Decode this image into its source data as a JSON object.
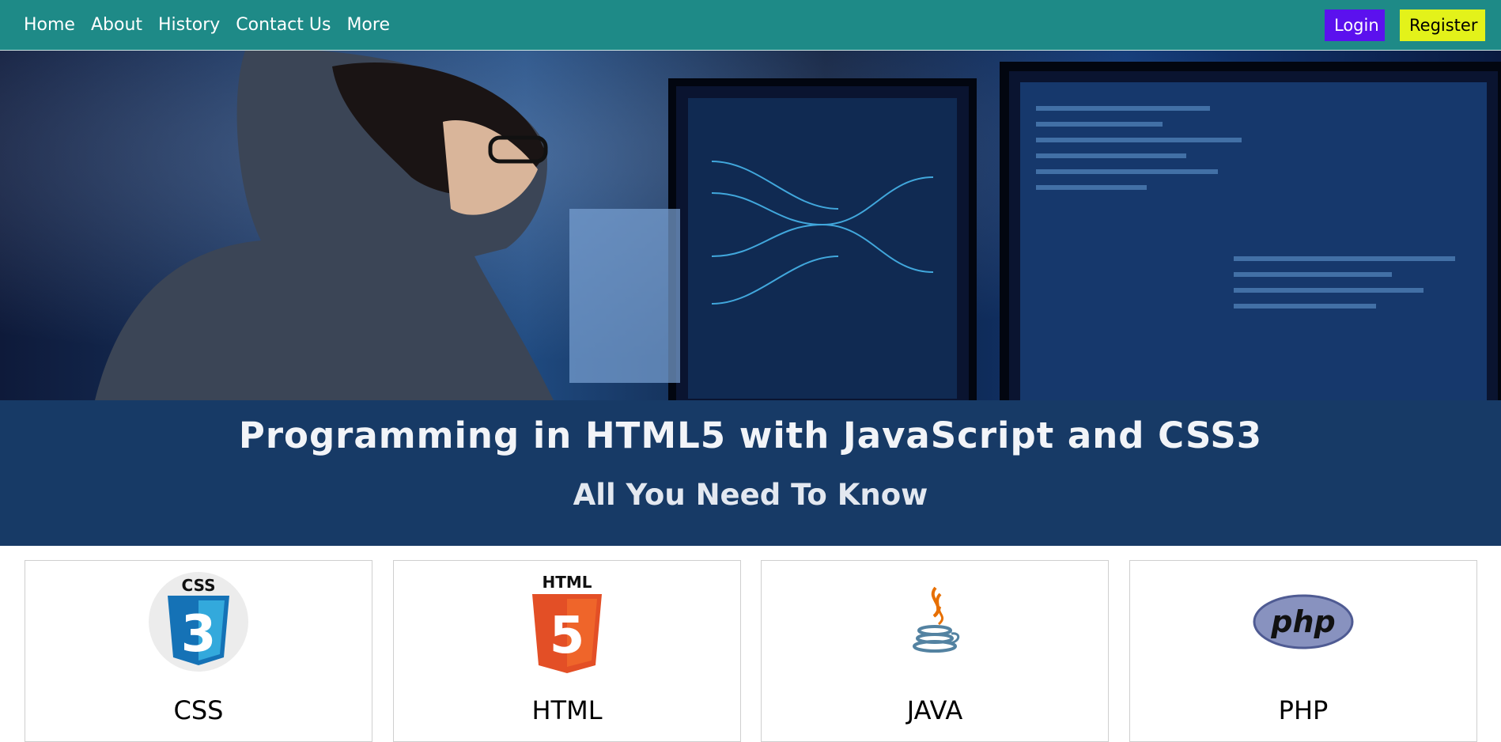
{
  "nav": {
    "links": [
      "Home",
      "About",
      "History",
      "Contact Us",
      "More"
    ],
    "login_label": "Login",
    "register_label": "Register",
    "bar_color": "#1e8a87",
    "login_color": "#5b11ee",
    "register_color": "#e3f21a"
  },
  "hero": {
    "title": "Programming in HTML5 with JavaScript and CSS3",
    "subtitle": "All You Need To Know",
    "banner_color": "#173a66"
  },
  "cards": [
    {
      "title": "CSS",
      "logo_text": "CSS",
      "logo_number": "3",
      "icon": "css3-logo-icon"
    },
    {
      "title": "HTML",
      "logo_text": "HTML",
      "logo_number": "5",
      "icon": "html5-logo-icon"
    },
    {
      "title": "JAVA",
      "icon": "java-logo-icon"
    },
    {
      "title": "PHP",
      "logo_text": "php",
      "icon": "php-logo-icon"
    }
  ]
}
